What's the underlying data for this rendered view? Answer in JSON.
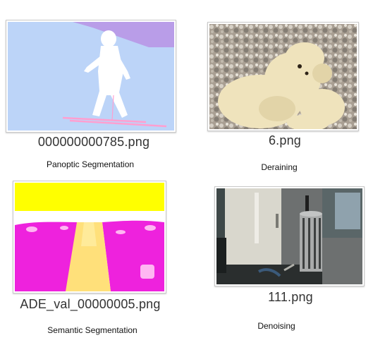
{
  "files": [
    {
      "filename": "000000000785.png",
      "caption": "Panoptic Segmentation",
      "icon": "panoptic-thumbnail"
    },
    {
      "filename": "6.png",
      "caption": "Deraining",
      "icon": "polar-bear-thumbnail"
    },
    {
      "filename": "ADE_val_00000005.png",
      "caption": "Semantic Segmentation",
      "icon": "semantic-thumbnail"
    },
    {
      "filename": "111.png",
      "caption": "Denoising",
      "icon": "kitchen-thumbnail"
    }
  ]
}
